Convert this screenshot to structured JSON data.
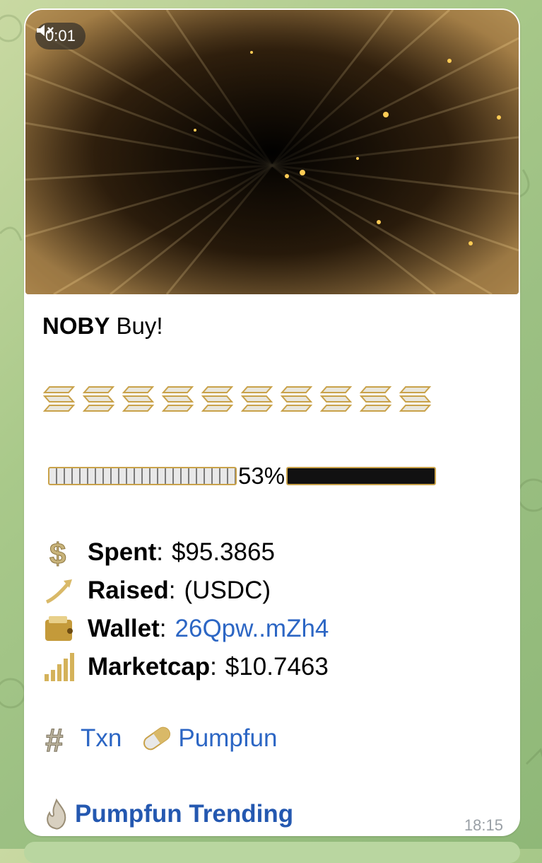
{
  "video": {
    "duration": "0:01",
    "muted": true
  },
  "message": {
    "title_bold": "NOBY",
    "title_rest": "Buy!",
    "emoji_count": 10,
    "progress": {
      "percent_label": "53%",
      "percent": 53
    },
    "stats": [
      {
        "icon": "dollar-sign-icon",
        "label": "Spent",
        "value": "$95.3865",
        "is_link": false
      },
      {
        "icon": "chart-arrow-icon",
        "label": "Raised",
        "value": " (USDC)",
        "is_link": false
      },
      {
        "icon": "wallet-icon",
        "label": "Wallet",
        "value": "26Qpw..mZh4",
        "is_link": true
      },
      {
        "icon": "bar-chart-icon",
        "label": "Marketcap",
        "value": "$10.7463",
        "is_link": false
      }
    ],
    "links": [
      {
        "icon": "hashtag-icon",
        "label": "Txn"
      },
      {
        "icon": "pill-icon",
        "label": "Pumpfun"
      }
    ],
    "trending": {
      "icon": "fire-icon",
      "label": "Pumpfun Trending"
    },
    "time": "18:15"
  },
  "colors": {
    "link": "#2c66c4",
    "accent_gold": "#c9a24a",
    "bubble": "#ffffff"
  }
}
